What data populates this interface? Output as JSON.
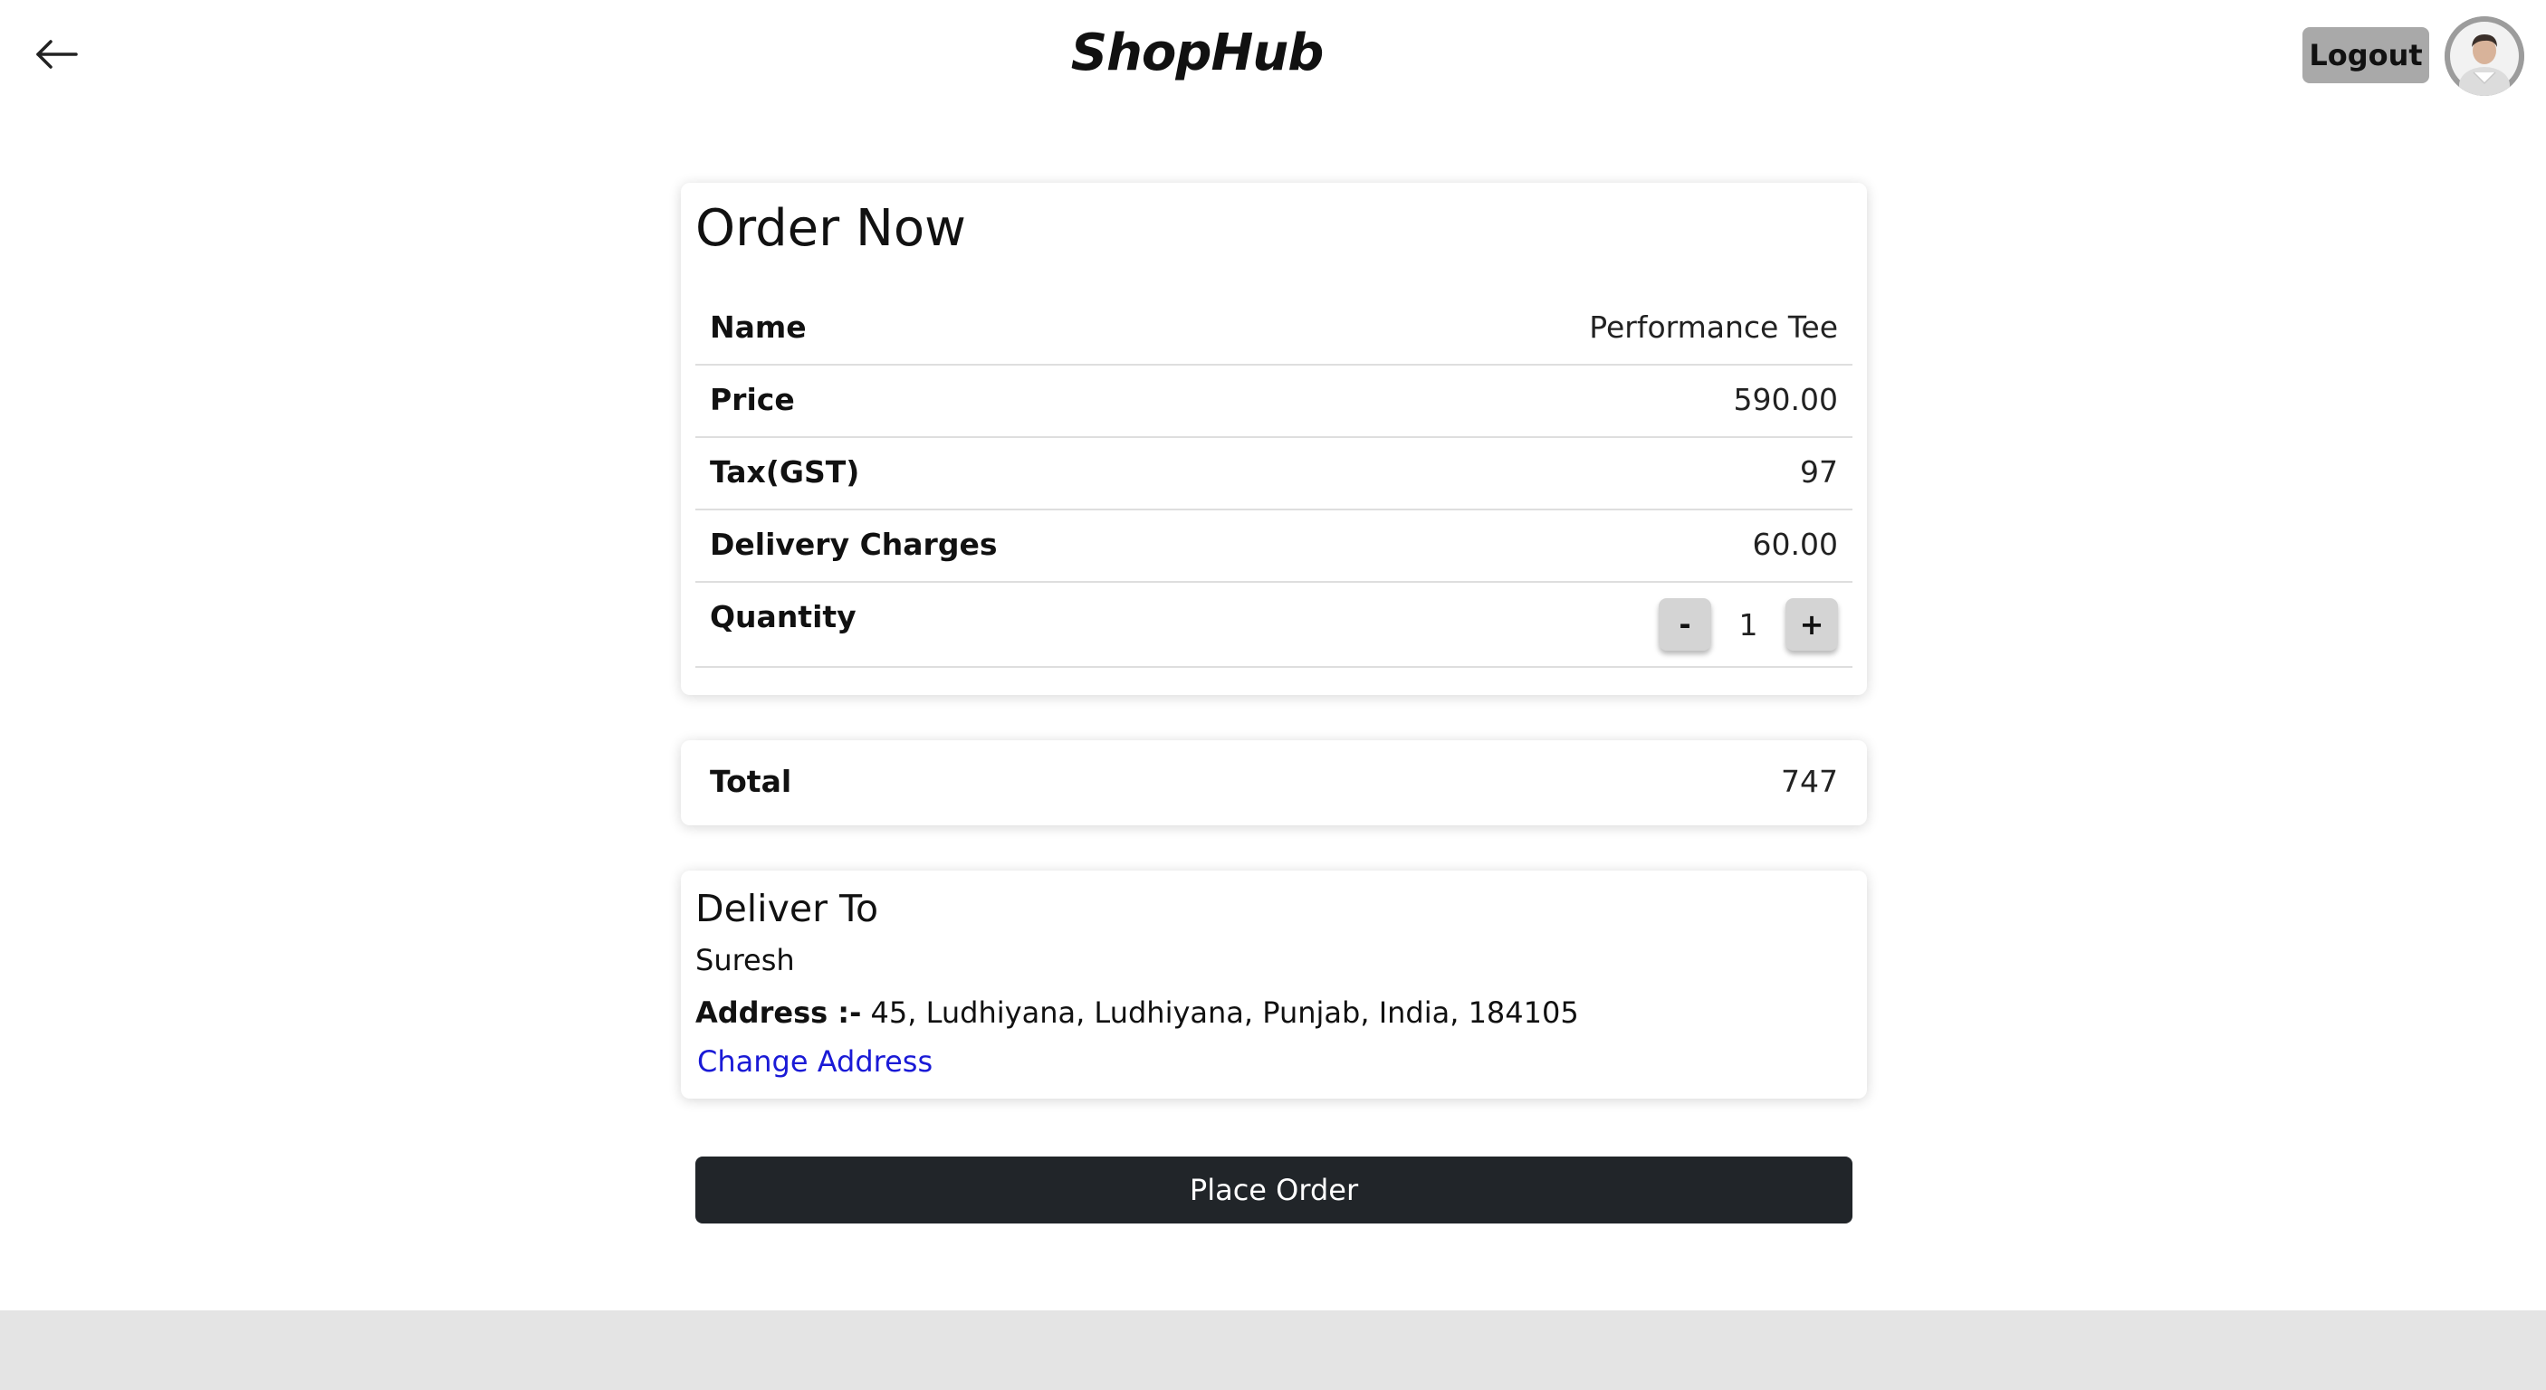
{
  "header": {
    "brand": "ShopHub",
    "logout_label": "Logout",
    "back_icon": "arrow-left-icon",
    "avatar_icon": "user-avatar"
  },
  "order": {
    "title": "Order Now",
    "rows": [
      {
        "label": "Name",
        "value": "Performance Tee"
      },
      {
        "label": "Price",
        "value": "590.00"
      },
      {
        "label": "Tax(GST)",
        "value": "97"
      },
      {
        "label": "Delivery Charges",
        "value": "60.00"
      }
    ],
    "quantity": {
      "label": "Quantity",
      "decrement_label": "-",
      "value": "1",
      "increment_label": "+"
    }
  },
  "total": {
    "label": "Total",
    "value": "747"
  },
  "delivery": {
    "title": "Deliver To",
    "name": "Suresh",
    "address_label": "Address :-",
    "address": " 45, Ludhiyana, Ludhiyana, Punjab, India, 184105",
    "change_address_label": "Change Address"
  },
  "actions": {
    "place_order_label": "Place Order"
  },
  "colors": {
    "accent_dark": "#212529",
    "link": "#1a1ad6",
    "logout_bg": "#a9a9a9",
    "footer_bg": "#e4e4e4"
  }
}
